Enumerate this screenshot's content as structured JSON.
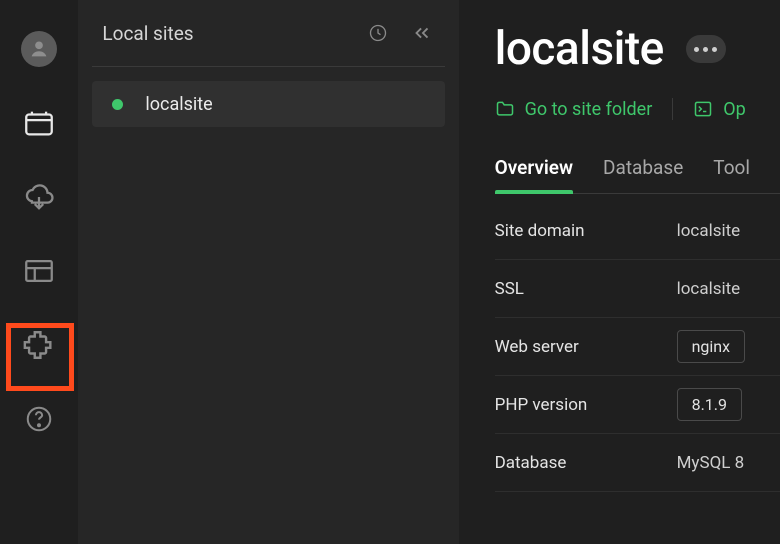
{
  "rail": {
    "iconNames": [
      "user",
      "browser",
      "cloud-download",
      "blueprint",
      "plugin",
      "help"
    ]
  },
  "sidebar": {
    "title": "Local sites",
    "items": [
      {
        "name": "localsite",
        "status": "running"
      }
    ]
  },
  "main": {
    "siteTitle": "localsite",
    "actions": {
      "folderLabel": "Go to site folder",
      "shellLabel": "Op"
    },
    "tabs": [
      "Overview",
      "Database",
      "Tool"
    ],
    "activeTab": 0,
    "info": [
      {
        "label": "Site domain",
        "value": "localsite",
        "type": "text"
      },
      {
        "label": "SSL",
        "value": "localsite",
        "type": "text"
      },
      {
        "label": "Web server",
        "value": "nginx",
        "type": "select"
      },
      {
        "label": "PHP version",
        "value": "8.1.9",
        "type": "select"
      },
      {
        "label": "Database",
        "value": "MySQL 8",
        "type": "text"
      }
    ]
  },
  "colors": {
    "accent": "#3fc76b",
    "highlight": "#ff4a1c"
  }
}
